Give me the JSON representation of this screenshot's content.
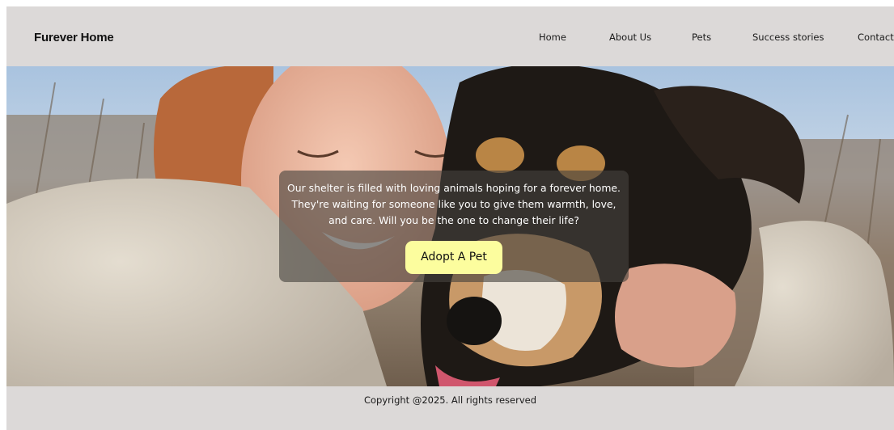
{
  "header": {
    "brand": "Furever Home",
    "nav": [
      "Home",
      "About Us",
      "Pets",
      "Success stories",
      "Contact"
    ]
  },
  "hero": {
    "image_alt": "woman-hugging-dog-photo",
    "message": "Our shelter is filled with loving animals hoping for a forever home. They're waiting for someone like you to give them warmth, love, and care. Will you be the one to change their life?",
    "cta_label": "Adopt A Pet"
  },
  "footer": {
    "copyright": "Copyright @2025. All rights reserved"
  },
  "colors": {
    "background": "#dcd9d8",
    "cta": "#fcfd9e",
    "overlay": "#46423e"
  }
}
